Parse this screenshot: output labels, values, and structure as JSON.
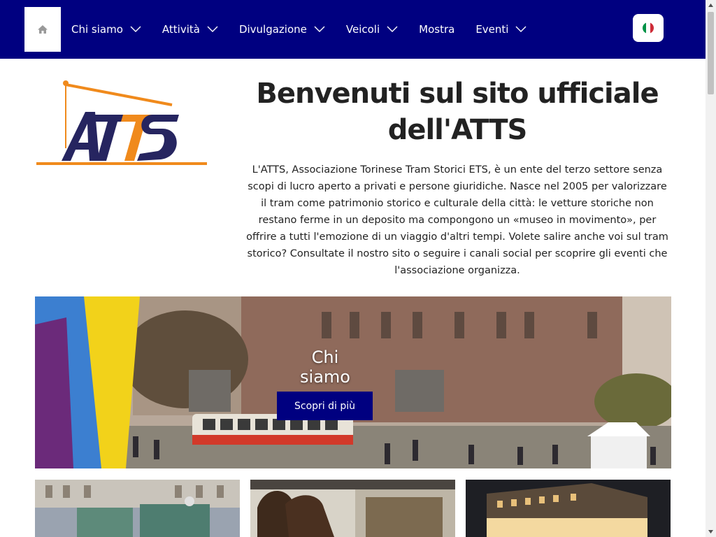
{
  "nav": {
    "home_icon": "home-icon",
    "items": [
      {
        "label": "Chi siamo",
        "has_dropdown": true
      },
      {
        "label": "Attività",
        "has_dropdown": true
      },
      {
        "label": "Divulgazione",
        "has_dropdown": true
      },
      {
        "label": "Veicoli",
        "has_dropdown": true
      },
      {
        "label": "Mostra",
        "has_dropdown": false
      },
      {
        "label": "Eventi",
        "has_dropdown": true
      }
    ],
    "language_icon": "italian-flag-icon"
  },
  "logo": {
    "mark": "ATTS",
    "subtitle": "Associazione Torinese Tram Storici ETS"
  },
  "welcome": {
    "title": "Benvenuti sul sito ufficiale dell'ATTS",
    "text": "L'ATTS, Associazione Torinese Tram Storici ETS, è un ente del terzo settore senza scopi di lucro aperto a privati e persone giuridiche. Nasce nel 2005 per valorizzare il tram come patrimonio storico e culturale della città: le vetture storiche non restano ferme in un deposito ma compongono un «museo in movimento», per offrire a tutti l'emozione di un viaggio d'altri tempi. Volete salire anche voi sul tram storico? Consultate il nostro sito o seguire i canali social per scoprire gli eventi che l'associazione organizza."
  },
  "hero": {
    "title": "Chi siamo",
    "button_label": "Scopri di più"
  },
  "colors": {
    "navbar": "#000080",
    "logo_navy": "#1e1e5a",
    "logo_orange": "#f08a1c"
  }
}
